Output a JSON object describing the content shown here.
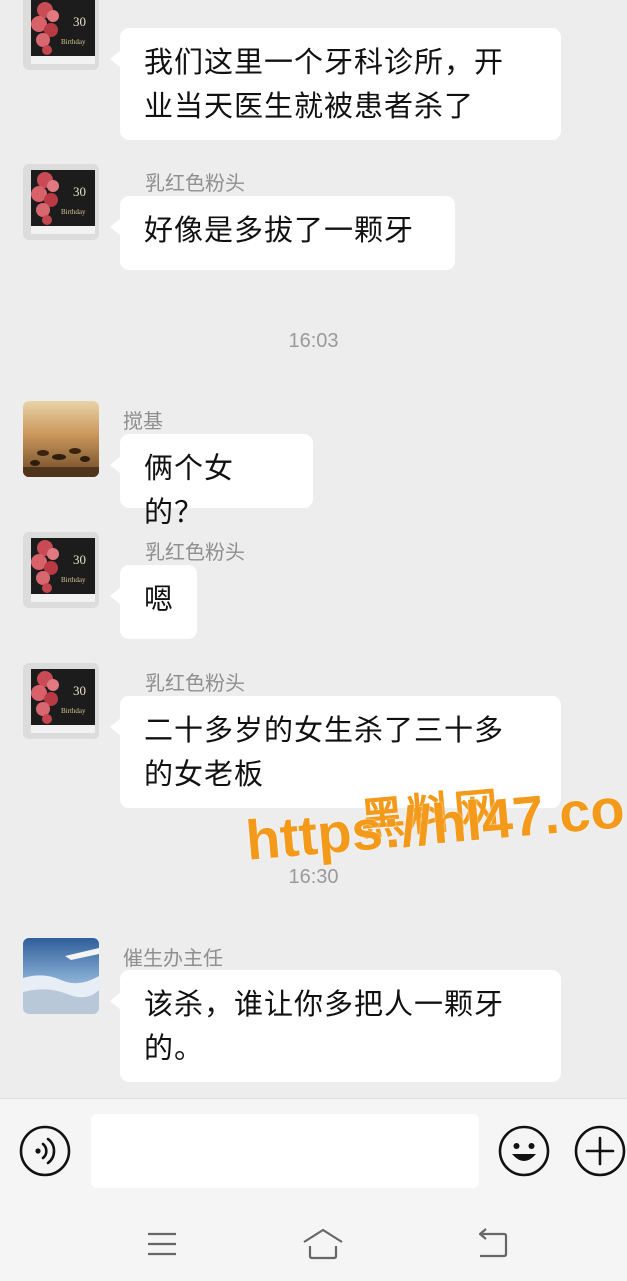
{
  "colors": {
    "background": "#ededed",
    "bubble": "#ffffff",
    "watermark": "#f39a1a"
  },
  "chat": {
    "messages": [
      {
        "avatar": "orchid-cake-photo",
        "lines": [
          "我们这里一个牙科诊所，开",
          "业当天医生就被患者杀了"
        ]
      },
      {
        "avatar": "orchid-cake-photo",
        "sender": "乳红色粉头",
        "lines": [
          "好像是多拔了一颗牙"
        ]
      },
      {
        "avatar": "horses-desert-photo",
        "sender": "搅基",
        "lines": [
          "俩个女的？"
        ]
      },
      {
        "avatar": "orchid-cake-photo",
        "sender": "乳红色粉头",
        "lines": [
          "嗯"
        ]
      },
      {
        "avatar": "orchid-cake-photo",
        "sender": "乳红色粉头",
        "lines": [
          "二十多岁的女生杀了三十多",
          "的女老板"
        ]
      },
      {
        "avatar": "airplane-clouds-photo",
        "sender": "催生办主任",
        "lines": [
          "该杀，谁让你多把人一颗牙",
          "的。"
        ]
      }
    ],
    "timestamps": [
      "16:03",
      "16:30"
    ]
  },
  "watermark": {
    "brand": "黑料网",
    "url": "https://hl47.co"
  },
  "input_bar": {
    "voice_icon": "voice-icon",
    "emoji_icon": "emoji-icon",
    "plus_icon": "plus-icon",
    "text_value": ""
  },
  "nav_bar": {
    "icons": [
      "menu-icon",
      "home-icon",
      "back-icon"
    ]
  }
}
